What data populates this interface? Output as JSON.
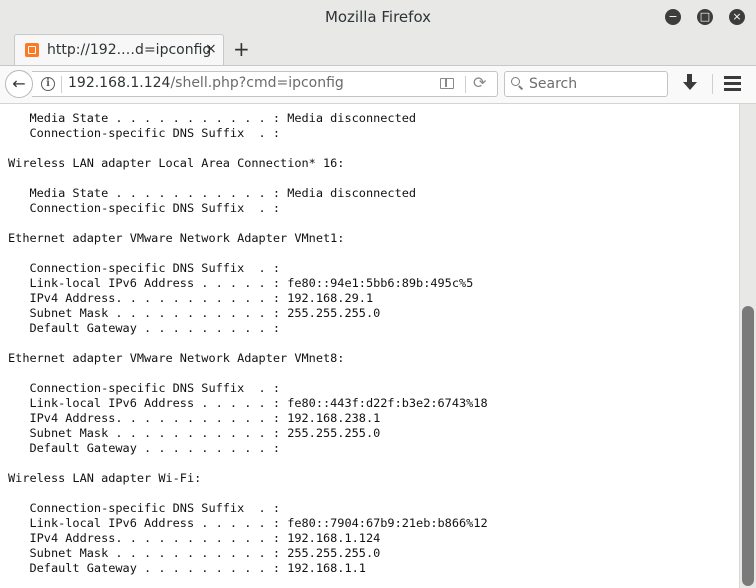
{
  "window": {
    "title": "Mozilla Firefox",
    "controls": {
      "minimize": "−",
      "maximize": "□",
      "close": "×"
    }
  },
  "tab": {
    "title": "http://192.…d=ipconfig",
    "close": "×",
    "new_tab": "+"
  },
  "nav": {
    "back": "←",
    "url_host": "192.168.1.124",
    "url_path": "/shell.php?cmd=ipconfig",
    "reload": "⟳",
    "info": "i",
    "search_placeholder": "Search"
  },
  "content": {
    "output": "   Media State . . . . . . . . . . . : Media disconnected\n   Connection-specific DNS Suffix  . :\n\nWireless LAN adapter Local Area Connection* 16:\n\n   Media State . . . . . . . . . . . : Media disconnected\n   Connection-specific DNS Suffix  . :\n\nEthernet adapter VMware Network Adapter VMnet1:\n\n   Connection-specific DNS Suffix  . :\n   Link-local IPv6 Address . . . . . : fe80::94e1:5bb6:89b:495c%5\n   IPv4 Address. . . . . . . . . . . : 192.168.29.1\n   Subnet Mask . . . . . . . . . . . : 255.255.255.0\n   Default Gateway . . . . . . . . . :\n\nEthernet adapter VMware Network Adapter VMnet8:\n\n   Connection-specific DNS Suffix  . :\n   Link-local IPv6 Address . . . . . : fe80::443f:d22f:b3e2:6743%18\n   IPv4 Address. . . . . . . . . . . : 192.168.238.1\n   Subnet Mask . . . . . . . . . . . : 255.255.255.0\n   Default Gateway . . . . . . . . . :\n\nWireless LAN adapter Wi-Fi:\n\n   Connection-specific DNS Suffix  . :\n   Link-local IPv6 Address . . . . . : fe80::7904:67b9:21eb:b866%12\n   IPv4 Address. . . . . . . . . . . : 192.168.1.124\n   Subnet Mask . . . . . . . . . . . : 255.255.255.0\n   Default Gateway . . . . . . . . . : 192.168.1.1"
  }
}
